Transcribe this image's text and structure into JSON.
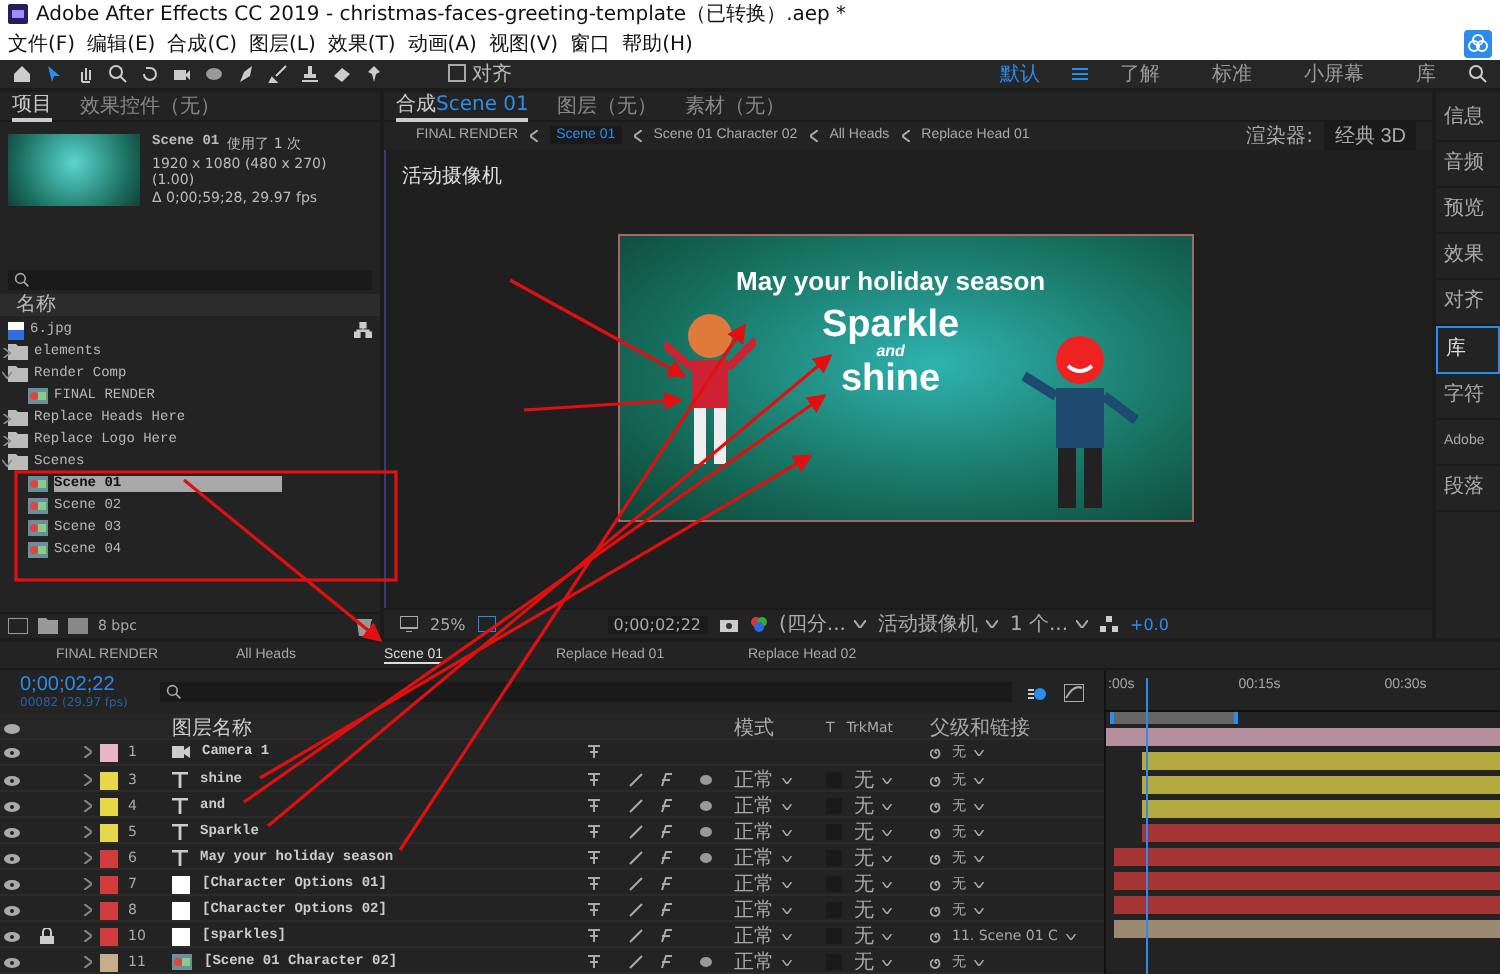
{
  "window": {
    "title": "Adobe After Effects CC 2019 - christmas-faces-greeting-template（已转换）.aep *"
  },
  "menu": [
    "文件(F)",
    "编辑(E)",
    "合成(C)",
    "图层(L)",
    "效果(T)",
    "动画(A)",
    "视图(V)",
    "窗口",
    "帮助(H)"
  ],
  "toolbar": {
    "snap_label": "对齐",
    "snap_checked": false,
    "workspaces": [
      {
        "label": "默认",
        "selected": true
      },
      {
        "label": "了解",
        "selected": false
      },
      {
        "label": "标准",
        "selected": false
      },
      {
        "label": "小屏幕",
        "selected": false
      },
      {
        "label": "库",
        "selected": false
      }
    ]
  },
  "project": {
    "tabs": [
      {
        "label": "项目",
        "selected": true
      },
      {
        "label": "效果控件（无）",
        "selected": false
      }
    ],
    "preview": {
      "name": "Scene 01",
      "usage": "使用了 1 次",
      "size": "1920 x 1080  (480 x 270) (1.00)",
      "duration": "Δ 0;00;59;28, 29.97 fps"
    },
    "column": "名称",
    "items": [
      {
        "kind": "image",
        "name": "6.jpg",
        "selected": false
      },
      {
        "kind": "folder",
        "name": "elements",
        "selected": false,
        "expanded": false
      },
      {
        "kind": "folder",
        "name": "Render Comp",
        "selected": false,
        "expanded": true,
        "children": [
          {
            "kind": "comp",
            "name": "FINAL RENDER",
            "selected": false
          }
        ]
      },
      {
        "kind": "folder",
        "name": "Replace Heads Here",
        "selected": false,
        "expanded": false
      },
      {
        "kind": "folder",
        "name": "Replace Logo Here",
        "selected": false,
        "expanded": false
      },
      {
        "kind": "folder",
        "name": "Scenes",
        "selected": false,
        "expanded": true,
        "children": [
          {
            "kind": "comp",
            "name": "Scene 01",
            "selected": true
          },
          {
            "kind": "comp",
            "name": "Scene 02",
            "selected": false
          },
          {
            "kind": "comp",
            "name": "Scene 03",
            "selected": false
          },
          {
            "kind": "comp",
            "name": "Scene 04",
            "selected": false
          }
        ]
      }
    ],
    "bit_depth": "8 bpc"
  },
  "composition": {
    "tabs": [
      {
        "label": "合成",
        "comp": "Scene 01",
        "selected": true
      },
      {
        "label": "图层（无）",
        "selected": false
      },
      {
        "label": "素材（无）",
        "selected": false
      }
    ],
    "breadcrumbs": [
      {
        "label": "FINAL RENDER",
        "selected": false
      },
      {
        "label": "Scene 01",
        "selected": true
      },
      {
        "label": "Scene 01 Character 02",
        "selected": false
      },
      {
        "label": "All Heads",
        "selected": false
      },
      {
        "label": "Replace Head 01",
        "selected": false
      }
    ],
    "renderer_label": "渲染器:",
    "renderer": "经典 3D",
    "camera_label": "活动摄像机",
    "canvas_lines": [
      "May your holiday season",
      "Sparkle",
      "and",
      "shine"
    ],
    "zoom": "25%",
    "timecode": "0;00;02;22",
    "resolution": "(四分...",
    "view": "活动摄像机",
    "views": "1 个...",
    "exposure": "+0.0"
  },
  "side_panel": [
    {
      "label": "信息",
      "selected": false
    },
    {
      "label": "音频",
      "selected": false
    },
    {
      "label": "预览",
      "selected": false
    },
    {
      "label": "效果",
      "selected": false
    },
    {
      "label": "对齐",
      "selected": false
    },
    {
      "label": "库",
      "selected": true
    },
    {
      "label": "字符",
      "selected": false
    },
    {
      "label": "Adobe",
      "selected": false
    },
    {
      "label": "段落",
      "selected": false
    }
  ],
  "timeline": {
    "tabs": [
      {
        "label": "FINAL RENDER",
        "selected": false
      },
      {
        "label": "All Heads",
        "selected": false
      },
      {
        "label": "Scene 01",
        "selected": true
      },
      {
        "label": "Replace Head 01",
        "selected": false
      },
      {
        "label": "Replace Head 02",
        "selected": false
      }
    ],
    "timecode": "0;00;02;22",
    "frame": "00082 (29.97 fps)",
    "columns": {
      "name": "图层名称",
      "mode": "模式",
      "t": "T",
      "trkmat": "TrkMat",
      "parent": "父级和链接"
    },
    "ruler": [
      ":00s",
      "00:15s",
      "00:30s"
    ],
    "layers": [
      {
        "number": "1",
        "kind": "camera",
        "name": "Camera 1",
        "color": "#e8b4c8",
        "locked": false,
        "parent": "无"
      },
      {
        "number": "3",
        "kind": "text",
        "name": "shine",
        "color": "#e6d84a",
        "locked": false,
        "mode": "正常",
        "trkmat": "无",
        "parent": "无"
      },
      {
        "number": "4",
        "kind": "text",
        "name": "and",
        "color": "#e6d84a",
        "locked": false,
        "mode": "正常",
        "trkmat": "无",
        "parent": "无"
      },
      {
        "number": "5",
        "kind": "text",
        "name": "Sparkle",
        "color": "#e6d84a",
        "locked": false,
        "mode": "正常",
        "trkmat": "无",
        "parent": "无"
      },
      {
        "number": "6",
        "kind": "text",
        "name": "May your holiday season",
        "color": "#d23c3c",
        "locked": false,
        "mode": "正常",
        "trkmat": "无",
        "parent": "无"
      },
      {
        "number": "7",
        "kind": "solid",
        "name": "[Character Options 01]",
        "color": "#d23c3c",
        "locked": false,
        "mode": "正常",
        "trkmat": "无",
        "parent": "无"
      },
      {
        "number": "8",
        "kind": "solid",
        "name": "[Character Options 02]",
        "color": "#d23c3c",
        "locked": false,
        "mode": "正常",
        "trkmat": "无",
        "parent": "无"
      },
      {
        "number": "10",
        "kind": "solid",
        "name": "[sparkles]",
        "color": "#d23c3c",
        "locked": true,
        "mode": "正常",
        "trkmat": "无",
        "parent": "11. Scene 01 C"
      },
      {
        "number": "11",
        "kind": "comp",
        "name": "[Scene 01 Character 02]",
        "color": "#c4ae8c",
        "locked": false,
        "mode": "正常",
        "trkmat": "无",
        "parent": "无"
      }
    ]
  }
}
